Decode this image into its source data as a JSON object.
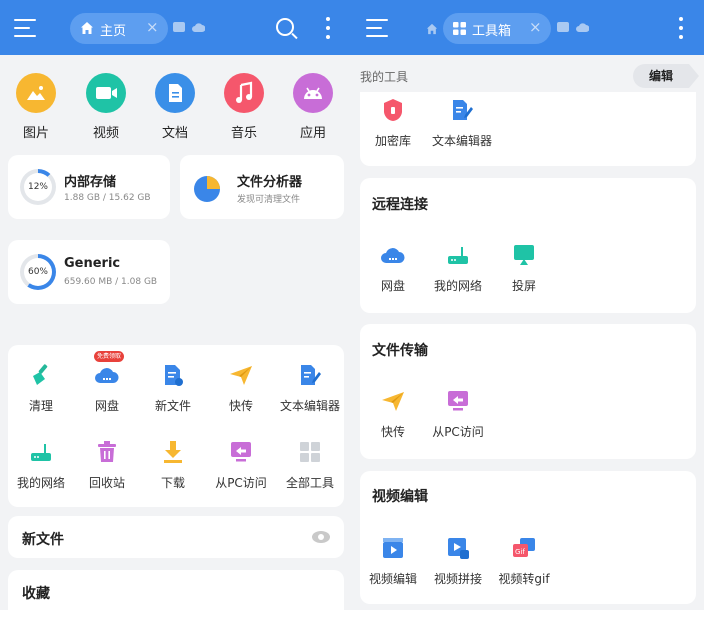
{
  "left": {
    "tab_label": "主页",
    "categories": [
      {
        "label": "图片",
        "icon": "image-icon",
        "color": "#f7b731"
      },
      {
        "label": "视频",
        "icon": "video-icon",
        "color": "#1fc3a6"
      },
      {
        "label": "文档",
        "icon": "document-icon",
        "color": "#3a8fe8"
      },
      {
        "label": "音乐",
        "icon": "music-icon",
        "color": "#f5576c"
      },
      {
        "label": "应用",
        "icon": "android-icon",
        "color": "#c86dd7"
      }
    ],
    "internal_storage": {
      "title": "内部存储",
      "used": "1.88 GB / 15.62 GB",
      "percent_label": "12%",
      "fraction": 0.12
    },
    "file_analyzer": {
      "title": "文件分析器",
      "subtitle": "发现可清理文件"
    },
    "generic_storage": {
      "title": "Generic",
      "used": "659.60 MB / 1.08 GB",
      "percent_label": "60%",
      "fraction": 0.6
    },
    "tools": [
      {
        "label": "清理",
        "icon": "broom-icon"
      },
      {
        "label": "网盘",
        "icon": "cloud-icon"
      },
      {
        "label": "新文件",
        "icon": "new-file-icon"
      },
      {
        "label": "快传",
        "icon": "paper-plane-icon"
      },
      {
        "label": "文本编辑器",
        "icon": "text-editor-icon"
      },
      {
        "label": "我的网络",
        "icon": "router-icon"
      },
      {
        "label": "回收站",
        "icon": "trash-icon"
      },
      {
        "label": "下载",
        "icon": "download-icon"
      },
      {
        "label": "从PC访问",
        "icon": "monitor-icon"
      },
      {
        "label": "全部工具",
        "icon": "grid-icon"
      }
    ],
    "cloud_badge": "免费领取",
    "new_files_title": "新文件",
    "favorites_title": "收藏"
  },
  "right": {
    "tab_label": "工具箱",
    "my_tools_label": "我的工具",
    "edit_label": "编辑",
    "my_tools": [
      {
        "label": "加密库",
        "icon": "vault-icon"
      },
      {
        "label": "文本编辑器",
        "icon": "text-editor-icon"
      }
    ],
    "remote": {
      "title": "远程连接",
      "items": [
        {
          "label": "网盘",
          "icon": "cloud-icon"
        },
        {
          "label": "我的网络",
          "icon": "router-icon"
        },
        {
          "label": "投屏",
          "icon": "cast-icon"
        }
      ]
    },
    "transfer": {
      "title": "文件传输",
      "items": [
        {
          "label": "快传",
          "icon": "paper-plane-icon"
        },
        {
          "label": "从PC访问",
          "icon": "monitor-icon"
        }
      ]
    },
    "video": {
      "title": "视频编辑",
      "items": [
        {
          "label": "视频编辑",
          "icon": "video-edit-icon"
        },
        {
          "label": "视频拼接",
          "icon": "video-merge-icon"
        },
        {
          "label": "视频转gif",
          "icon": "gif-icon"
        }
      ]
    }
  },
  "colors": {
    "accent": "#3a86e8",
    "background": "#f2f3f5",
    "ring_track": "#e3e6ea"
  }
}
